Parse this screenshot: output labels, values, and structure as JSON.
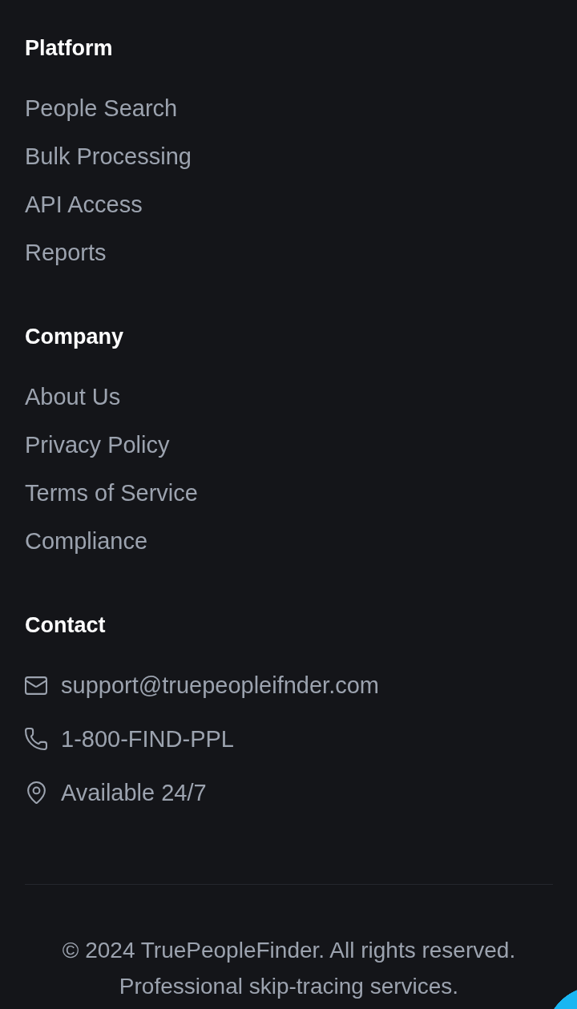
{
  "link_sections": [
    {
      "heading": "Platform",
      "links": [
        "People Search",
        "Bulk Processing",
        "API Access",
        "Reports"
      ]
    },
    {
      "heading": "Company",
      "links": [
        "About Us",
        "Privacy Policy",
        "Terms of Service",
        "Compliance"
      ]
    }
  ],
  "contact": {
    "heading": "Contact",
    "items": [
      {
        "kind": "email",
        "text": "support@truepeopleifnder.com"
      },
      {
        "kind": "phone",
        "text": "1-800-FIND-PPL"
      },
      {
        "kind": "location",
        "text": "Available 24/7"
      }
    ]
  },
  "bottom": {
    "copyright": "© 2024 TruePeopleFinder. All rights reserved.",
    "tagline": "Professional skip-tracing services."
  }
}
